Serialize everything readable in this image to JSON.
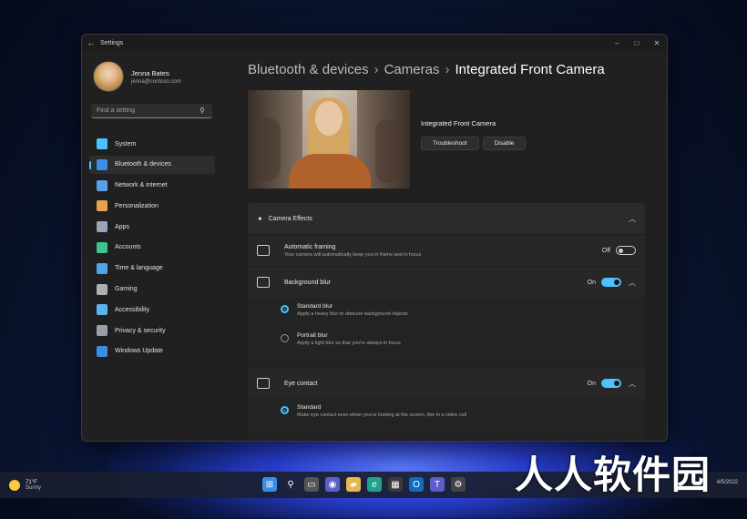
{
  "window": {
    "title": "Settings",
    "controls": {
      "minimize": "–",
      "maximize": "□",
      "close": "✕"
    }
  },
  "profile": {
    "name": "Jenna Bates",
    "email": "jenna@contoso.com"
  },
  "search": {
    "placeholder": "Find a setting"
  },
  "nav": [
    {
      "label": "System",
      "icon": "monitor-icon",
      "color": "#4cc2ff"
    },
    {
      "label": "Bluetooth & devices",
      "icon": "bluetooth-icon",
      "color": "#3a8ee6",
      "active": true
    },
    {
      "label": "Network & internet",
      "icon": "wifi-icon",
      "color": "#5aa0e8"
    },
    {
      "label": "Personalization",
      "icon": "brush-icon",
      "color": "#e8a24c"
    },
    {
      "label": "Apps",
      "icon": "apps-icon",
      "color": "#9aa6b8"
    },
    {
      "label": "Accounts",
      "icon": "person-icon",
      "color": "#3ec28f"
    },
    {
      "label": "Time & language",
      "icon": "globe-clock-icon",
      "color": "#4aa8e8"
    },
    {
      "label": "Gaming",
      "icon": "controller-icon",
      "color": "#b0b0b0"
    },
    {
      "label": "Accessibility",
      "icon": "accessibility-icon",
      "color": "#5ab4f0"
    },
    {
      "label": "Privacy & security",
      "icon": "shield-icon",
      "color": "#9aa0a8"
    },
    {
      "label": "Windows Update",
      "icon": "update-icon",
      "color": "#3b8de6"
    }
  ],
  "breadcrumb": {
    "part1": "Bluetooth & devices",
    "part2": "Cameras",
    "current": "Integrated Front Camera",
    "sep": "›"
  },
  "camera": {
    "name": "Integrated Front Camera",
    "troubleshoot": "Troubleshoot",
    "disable": "Disable"
  },
  "effects": {
    "header": "Camera Effects",
    "auto_framing": {
      "title": "Automatic framing",
      "desc": "Your camera will automatically keep you in frame and in focus",
      "state": "Off"
    },
    "background_blur": {
      "title": "Background blur",
      "state": "On",
      "options": [
        {
          "title": "Standard blur",
          "desc": "Apply a heavy blur to obscure background objects",
          "selected": true
        },
        {
          "title": "Portrait blur",
          "desc": "Apply a light blur so that you're always in focus",
          "selected": false
        }
      ]
    },
    "eye_contact": {
      "title": "Eye contact",
      "state": "On",
      "options": [
        {
          "title": "Standard",
          "desc": "Make eye contact even when you're looking at the screen, like in a video call",
          "selected": true
        }
      ]
    }
  },
  "taskbar": {
    "weather_temp": "71°F",
    "weather_desc": "Sunny",
    "date": "4/5/2022"
  },
  "watermark": "人人软件园",
  "accent": "#4cc2ff"
}
